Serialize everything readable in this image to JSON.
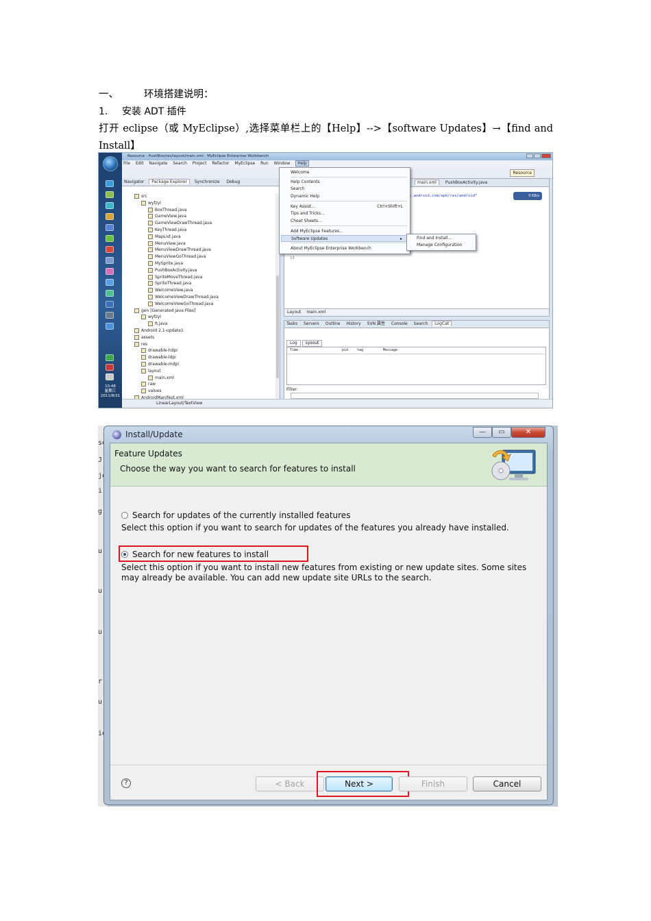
{
  "doc": {
    "heading1_num": "一、",
    "heading1_text": "环境搭建说明：",
    "heading2_num": "1.",
    "heading2_text": "安装 ADT 插件",
    "paragraph": "打开 eclipse（或 MyEclipse）,选择菜单栏上的【Help】-->【software Updates】→【find and Install】"
  },
  "eclipse": {
    "title": "Resource - PushBox/res/layout/main.xml - MyEclipse Enterprise Workbench",
    "menubar": [
      "File",
      "Edit",
      "Navigate",
      "Search",
      "Project",
      "Refactor",
      "MyEclipse",
      "Run",
      "Window",
      "Help"
    ],
    "perspective": "Resource",
    "left_tabs": [
      "Navigator",
      "Package Explorer",
      "Synchronize",
      "Debug"
    ],
    "tree": [
      "src",
      "wyfzyl",
      "BoxThread.java",
      "GameView.java",
      "GameViewDrawThread.java",
      "KeyThread.java",
      "MapList.java",
      "MenuView.java",
      "MenuViewDrawThread.java",
      "MenuViewGoThread.java",
      "MySprite.java",
      "PushBoxActivity.java",
      "SpriteMoveThread.java",
      "SpriteThread.java",
      "WelcomeView.java",
      "WelcomeViewDrawThread.java",
      "WelcomeViewGoThread.java",
      "gen [Generated Java Files]",
      "wyfzyl",
      "R.java",
      "Android 2.1-update1",
      "assets",
      "res",
      "drawable-hdpi",
      "drawable-ldpi",
      "drawable-mdpi",
      "layout",
      "main.xml",
      "raw",
      "values",
      "AndroidManifest.xml"
    ],
    "editor_tabs": [
      "main.xml",
      "PushBoxActivity.java"
    ],
    "code_line": "s.android.com/apk/res/android\"",
    "net_badge": "0 KB/s",
    "line_number": "13",
    "editor_bottom_tabs": [
      "Layout",
      "main.xml"
    ],
    "console_tabs": [
      "Tasks",
      "Servers",
      "Outline",
      "History",
      "SVN 属性",
      "Console",
      "Search",
      "LogCat"
    ],
    "log_tabs": [
      "Log",
      "sysout"
    ],
    "log_columns": [
      "Time",
      "pid",
      "tag",
      "Message"
    ],
    "filter_label": "Filter:",
    "status": "LinearLayout/TextView",
    "clock_time": "13:48",
    "clock_day": "星期三",
    "clock_date": "2011/8/31",
    "help_menu": {
      "welcome": "Welcome",
      "help_contents": "Help Contents",
      "search": "Search",
      "dynamic_help": "Dynamic Help",
      "key_assist": "Key Assist...",
      "key_assist_shortcut": "Ctrl+Shift+L",
      "tips": "Tips and Tricks...",
      "cheat": "Cheat Sheets...",
      "add_features": "Add MyEclipse Features...",
      "software_updates": "Software Updates",
      "about": "About MyEclipse Enterprise Workbench"
    },
    "sub_menu": {
      "find_install": "Find and Install...",
      "manage": "Manage Configuration"
    }
  },
  "dialog": {
    "title": "Install/Update",
    "header_title": "Feature Updates",
    "header_desc": "Choose the way you want to search for features to install",
    "option1_label": "Search for updates of the currently installed features",
    "option1_desc": "Select this option if you want to search for updates of the features you already have installed.",
    "option2_label": "Search for new features to install",
    "option2_desc": "Select this option if you want to install new features from existing or new update sites. Some sites may already be available. You can add new update site URLs to the search.",
    "selected_option": 2,
    "help_glyph": "?",
    "btn_back": "< Back",
    "btn_next": "Next >",
    "btn_finish": "Finish",
    "btn_cancel": "Cancel",
    "behind_letters": [
      "se",
      "J",
      "je",
      "i",
      "g",
      "u",
      "u",
      "u",
      "r",
      "u",
      "ie"
    ],
    "highlight_color": "#e0141e"
  }
}
